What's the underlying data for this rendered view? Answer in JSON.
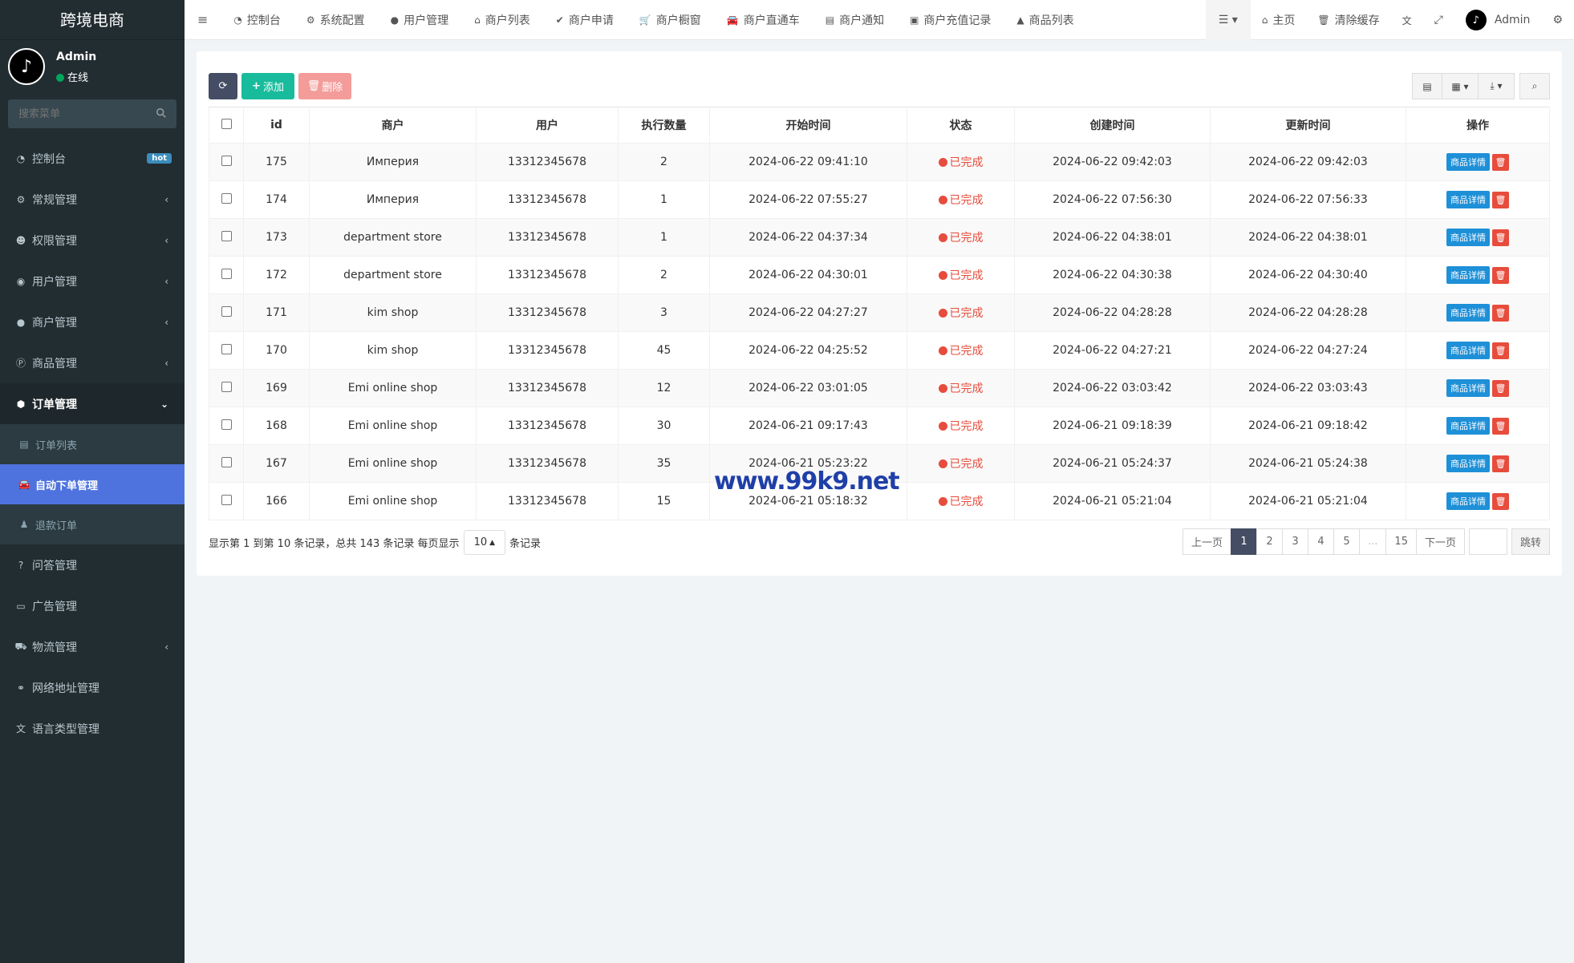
{
  "brand": "跨境电商",
  "user": {
    "name": "Admin",
    "status": "在线"
  },
  "sidebar": {
    "search_placeholder": "搜索菜单",
    "items": [
      {
        "label": "控制台",
        "badge": "hot"
      },
      {
        "label": "常规管理"
      },
      {
        "label": "权限管理"
      },
      {
        "label": "用户管理"
      },
      {
        "label": "商户管理"
      },
      {
        "label": "商品管理"
      },
      {
        "label": "订单管理"
      },
      {
        "label": "订单列表"
      },
      {
        "label": "自动下单管理"
      },
      {
        "label": "退款订单"
      },
      {
        "label": "问答管理"
      },
      {
        "label": "广告管理"
      },
      {
        "label": "物流管理"
      },
      {
        "label": "网络地址管理"
      },
      {
        "label": "语言类型管理"
      }
    ]
  },
  "topnav": {
    "tabs": [
      "控制台",
      "系统配置",
      "用户管理",
      "商户列表",
      "商户申请",
      "商户橱窗",
      "商户直通车",
      "商户通知",
      "商户充值记录",
      "商品列表"
    ],
    "home": "主页",
    "clear_cache": "清除缓存",
    "admin": "Admin"
  },
  "toolbar": {
    "add": "添加",
    "delete": "删除"
  },
  "table": {
    "headers": [
      "id",
      "商户",
      "用户",
      "执行数量",
      "开始时间",
      "状态",
      "创建时间",
      "更新时间",
      "操作"
    ],
    "detail_label": "商品详情",
    "rows": [
      {
        "id": "175",
        "merchant": "Империя",
        "user": "13312345678",
        "count": "2",
        "start": "2024-06-22 09:41:10",
        "status": "已完成",
        "created": "2024-06-22 09:42:03",
        "updated": "2024-06-22 09:42:03"
      },
      {
        "id": "174",
        "merchant": "Империя",
        "user": "13312345678",
        "count": "1",
        "start": "2024-06-22 07:55:27",
        "status": "已完成",
        "created": "2024-06-22 07:56:30",
        "updated": "2024-06-22 07:56:33"
      },
      {
        "id": "173",
        "merchant": "department store",
        "user": "13312345678",
        "count": "1",
        "start": "2024-06-22 04:37:34",
        "status": "已完成",
        "created": "2024-06-22 04:38:01",
        "updated": "2024-06-22 04:38:01"
      },
      {
        "id": "172",
        "merchant": "department store",
        "user": "13312345678",
        "count": "2",
        "start": "2024-06-22 04:30:01",
        "status": "已完成",
        "created": "2024-06-22 04:30:38",
        "updated": "2024-06-22 04:30:40"
      },
      {
        "id": "171",
        "merchant": "kim shop",
        "user": "13312345678",
        "count": "3",
        "start": "2024-06-22 04:27:27",
        "status": "已完成",
        "created": "2024-06-22 04:28:28",
        "updated": "2024-06-22 04:28:28"
      },
      {
        "id": "170",
        "merchant": "kim shop",
        "user": "13312345678",
        "count": "45",
        "start": "2024-06-22 04:25:52",
        "status": "已完成",
        "created": "2024-06-22 04:27:21",
        "updated": "2024-06-22 04:27:24"
      },
      {
        "id": "169",
        "merchant": "Emi online shop",
        "user": "13312345678",
        "count": "12",
        "start": "2024-06-22 03:01:05",
        "status": "已完成",
        "created": "2024-06-22 03:03:42",
        "updated": "2024-06-22 03:03:43"
      },
      {
        "id": "168",
        "merchant": "Emi online shop",
        "user": "13312345678",
        "count": "30",
        "start": "2024-06-21 09:17:43",
        "status": "已完成",
        "created": "2024-06-21 09:18:39",
        "updated": "2024-06-21 09:18:42"
      },
      {
        "id": "167",
        "merchant": "Emi online shop",
        "user": "13312345678",
        "count": "35",
        "start": "2024-06-21 05:23:22",
        "status": "已完成",
        "created": "2024-06-21 05:24:37",
        "updated": "2024-06-21 05:24:38"
      },
      {
        "id": "166",
        "merchant": "Emi online shop",
        "user": "13312345678",
        "count": "15",
        "start": "2024-06-21 05:18:32",
        "status": "已完成",
        "created": "2024-06-21 05:21:04",
        "updated": "2024-06-21 05:21:04"
      }
    ]
  },
  "pager": {
    "info_prefix": "显示第 1 到第 10 条记录，总共 143 条记录 每页显示",
    "page_size": "10",
    "info_suffix": "条记录",
    "prev": "上一页",
    "pages": [
      "1",
      "2",
      "3",
      "4",
      "5",
      "...",
      "15"
    ],
    "next": "下一页",
    "jump": "跳转"
  },
  "watermark": "www.99k9.net",
  "colors": {
    "sidebar": "#222d32",
    "active_menu": "#4e73df",
    "status_done": "#e74c3c",
    "add": "#18bc9c"
  }
}
